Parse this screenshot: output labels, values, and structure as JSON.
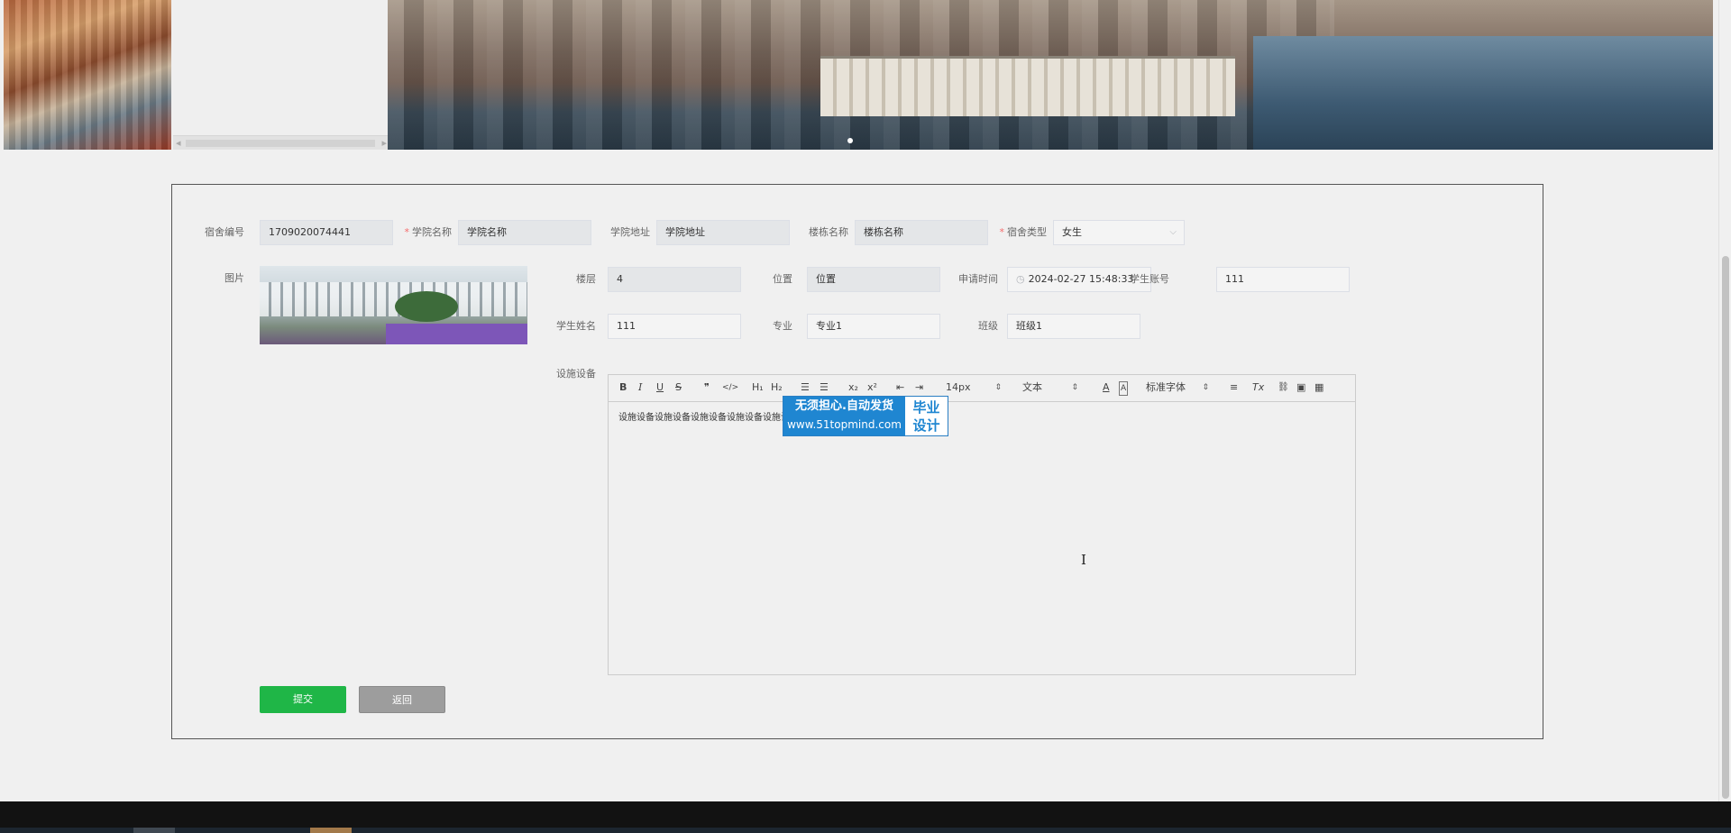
{
  "form": {
    "dorm_no": {
      "label": "宿舍编号",
      "value": "1709020074441"
    },
    "college_name": {
      "label": "学院名称",
      "required": "*",
      "value": "学院名称"
    },
    "college_address": {
      "label": "学院地址",
      "value": "学院地址"
    },
    "building_name": {
      "label": "楼栋名称",
      "value": "楼栋名称"
    },
    "dorm_type": {
      "label": "宿舍类型",
      "required": "*",
      "value": "女生"
    },
    "picture": {
      "label": "图片"
    },
    "floor": {
      "label": "楼层",
      "value": "4"
    },
    "location": {
      "label": "位置",
      "value": "位置"
    },
    "apply_time": {
      "label": "申请时间",
      "value": "2024-02-27 15:48:33"
    },
    "student_account": {
      "label": "学生账号",
      "value": "111"
    },
    "student_name": {
      "label": "学生姓名",
      "value": "111"
    },
    "major": {
      "label": "专业",
      "value": "专业1"
    },
    "class": {
      "label": "班级",
      "value": "班级1"
    },
    "facilities": {
      "label": "设施设备",
      "content": "设施设备设施设备设施设备设施设备设施设备设施设"
    }
  },
  "editor": {
    "toolbar": {
      "bold": "B",
      "italic": "I",
      "underline": "U",
      "strike": "S",
      "quote": "❞",
      "code": "</>",
      "h1": "H₁",
      "h2": "H₂",
      "ol": "☰",
      "ul": "☰",
      "sub": "x₂",
      "sup": "x²",
      "indent_dec": "⇤",
      "indent_inc": "⇥",
      "size": "14px",
      "format": "文本",
      "font": "标准字体",
      "align": "≡",
      "clear": "Tx",
      "link": "🔗",
      "image": "▣",
      "video": "▦"
    }
  },
  "buttons": {
    "submit": "提交",
    "back": "返回"
  },
  "watermark": {
    "line1": "无须担心.自动发货",
    "line2": "www.51topmind.com",
    "right1": "毕业",
    "right2": "设计"
  },
  "icons": {
    "select": "chevron-down-icon",
    "clock": "clock-icon",
    "cursor": "text-cursor-icon"
  },
  "colors": {
    "submit": "#1fb647",
    "back": "#9d9d9d",
    "required": "#f56c6c",
    "watermark": "#1f86d1"
  }
}
